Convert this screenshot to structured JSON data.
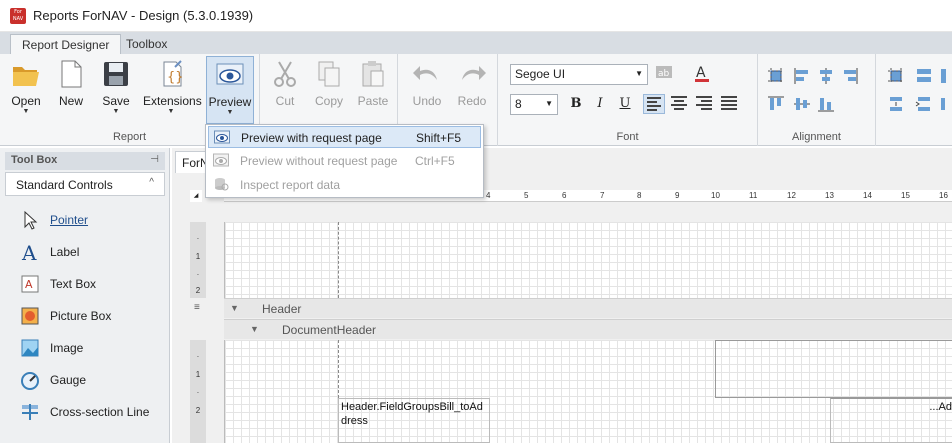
{
  "window": {
    "title": "Reports ForNAV - Design (5.3.0.1939)",
    "icon_text": "ForNAV"
  },
  "tabs": [
    {
      "label": "Report Designer",
      "active": true
    },
    {
      "label": "Toolbox",
      "active": false
    }
  ],
  "ribbon": {
    "report_group": {
      "label": "Report",
      "open": "Open",
      "new": "New",
      "save": "Save",
      "extensions": "Extensions",
      "preview": "Preview"
    },
    "clipboard": {
      "cut": "Cut",
      "copy": "Copy",
      "paste": "Paste"
    },
    "history": {
      "undo": "Undo",
      "redo": "Redo"
    },
    "font_group": {
      "label": "Font",
      "font_name": "Segoe UI",
      "font_size": "8",
      "bold": "B",
      "italic": "I",
      "underline": "U"
    },
    "alignment_group": {
      "label": "Alignment"
    }
  },
  "preview_menu": [
    {
      "label": "Preview with request page",
      "shortcut": "Shift+F5",
      "enabled": true,
      "icon": "eye-icon"
    },
    {
      "label": "Preview without request page",
      "shortcut": "Ctrl+F5",
      "enabled": false,
      "icon": "eye-icon"
    },
    {
      "label": "Inspect report data",
      "shortcut": "",
      "enabled": false,
      "icon": "data-icon"
    }
  ],
  "toolbox": {
    "header": "Tool Box",
    "group": "Standard Controls",
    "items": [
      {
        "label": "Pointer",
        "icon": "pointer-icon"
      },
      {
        "label": "Label",
        "icon": "label-icon"
      },
      {
        "label": "Text Box",
        "icon": "textbox-icon"
      },
      {
        "label": "Picture Box",
        "icon": "picturebox-icon"
      },
      {
        "label": "Image",
        "icon": "image-icon"
      },
      {
        "label": "Gauge",
        "icon": "gauge-icon"
      },
      {
        "label": "Cross-section Line",
        "icon": "cross-section-line-icon"
      }
    ]
  },
  "designer": {
    "doc_tab": "ForNAV",
    "ruler_labels": [
      "4",
      "5",
      "6",
      "7",
      "8",
      "9",
      "10",
      "11",
      "12",
      "13",
      "14",
      "15",
      "16"
    ],
    "vruler_top": [
      "·",
      "1",
      "·",
      "2"
    ],
    "vruler_bottom": [
      "·",
      "1",
      "·",
      "2"
    ],
    "bands": {
      "header": "Header",
      "document_header": "DocumentHeader"
    },
    "field_bill_to": "Header.FieldGroupsBill_toAddress",
    "field_right": "...Ad"
  },
  "colors": {
    "accent": "#2b579a",
    "menu_highlight": "#dce9f7",
    "app_icon": "#c9302c"
  }
}
